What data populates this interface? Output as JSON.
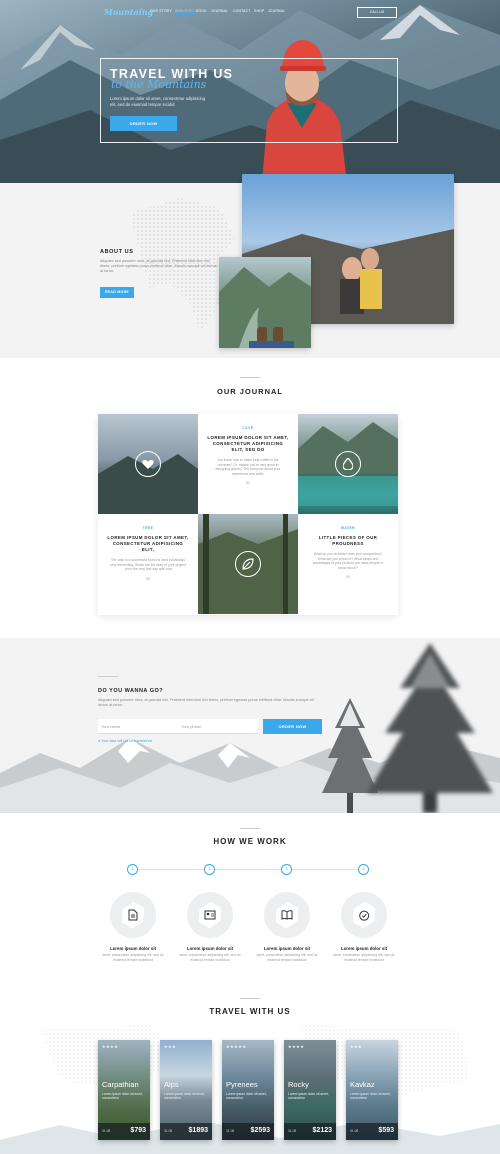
{
  "nav": {
    "logo": "Mountaing",
    "links": [
      "OUR STORY",
      "SERVICES",
      "BOOK",
      "JOURNAL",
      "CONTACT",
      "SHOP",
      "JOURNAL"
    ],
    "active_index": 1,
    "call_label": "CALL US"
  },
  "hero": {
    "title": "TRAVEL WITH US",
    "script_title": "to the Mountains",
    "desc_line1": "Lorem ipsum dolor sit amet, consectetur adipisicing",
    "desc_line2": "elit, sed do eiusmod tempor incidid",
    "button": "ORDER NOW"
  },
  "about": {
    "title": "ABOUT US",
    "text": "Aliquam sed posuere urna, at gravida nisl. Praesent interdum nisl libero, pretium egestas purus eleifend vitae. Mauris suscipit vel lectus at tortor.",
    "button": "READ MORE"
  },
  "journal": {
    "title": "OUR JOURNAL",
    "items": [
      {
        "tag": "LOVE",
        "title": "LOREM IPSUM DOLOR SIT AMET, CONSECTETUR ADIPISICING ELIT, SED DO",
        "text": "You know how to make best coffee in the universe? Or, maybe you're very good in designing gloves? Tell everyone about your experience and skills.",
        "num": "01"
      },
      {
        "tag": "TREE",
        "title": "LOREM IPSUM DOLOR SIT AMET, CONSECTETUR ADIPISICING ELIT,",
        "text": "The way to a successful brand is hard but always very interesting. Share the full story of your project - from the very first day until now.",
        "num": "02"
      },
      {
        "tag": "WATER",
        "title": "LITTLE PIECES OF OUR PROUDNESS",
        "text": "What do you do better than your competitors? What are you proud of? What ideals and advantages of your product you want people to know about?",
        "num": "03"
      }
    ],
    "icons": [
      "heart-icon",
      "drop-icon",
      "leaf-icon"
    ]
  },
  "go": {
    "title": "DO YOU WANNA GO?",
    "text": "Aliquam sed posuere urna, at gravida nisl. Praesent interdum nisl libero, pretium egestas purus eleifend vitae. Mauris suscipit vel lectus at tortor.",
    "name_placeholder": "Your name",
    "phone_placeholder": "Your phone",
    "button": "ORDER NOW",
    "note": "Your data will not be transferred"
  },
  "how": {
    "title": "HOW WE WORK",
    "steps": [
      {
        "num": "1",
        "icon": "document-icon",
        "title": "Lorem ipsum dolor sit",
        "text": "amet, consectetur adipisicing elit, sed do eiusmod tempor incididunt"
      },
      {
        "num": "2",
        "icon": "id-card-icon",
        "title": "Lorem ipsum dolor sit",
        "text": "amet, consectetur adipisicing elit, sed do eiusmod tempor incididunt"
      },
      {
        "num": "3",
        "icon": "book-icon",
        "title": "Lorem ipsum dolor sit",
        "text": "amet, consectetur adipisicing elit, sed do eiusmod tempor incididunt"
      },
      {
        "num": "4",
        "icon": "check-icon",
        "title": "Lorem ipsum dolor sit",
        "text": "amet, consectetur adipisicing elit, sed do eiusmod tempor incididunt"
      }
    ]
  },
  "travel": {
    "title": "TRAVEL WITH US",
    "cards": [
      {
        "stars": "★★★★",
        "name": "Carpathian",
        "desc": "Lorem ipsum dolor sit amet, consectetur",
        "date": "31.08",
        "price": "$793"
      },
      {
        "stars": "★★★",
        "name": "Alps",
        "desc": "Lorem ipsum dolor sit amet, consectetur",
        "date": "31.08",
        "price": "$1893"
      },
      {
        "stars": "★★★★★",
        "name": "Pyrenees",
        "desc": "Lorem ipsum dolor sit amet, consectetur",
        "date": "31.08",
        "price": "$2593"
      },
      {
        "stars": "★★★★",
        "name": "Rocky",
        "desc": "Lorem ipsum dolor sit amet, consectetur",
        "date": "31.08",
        "price": "$2123"
      },
      {
        "stars": "★★★",
        "name": "Kavkaz",
        "desc": "Lorem ipsum dolor sit amet, consectetur",
        "date": "31.08",
        "price": "$593"
      }
    ]
  },
  "colors": {
    "accent": "#3aa8ea",
    "dark": "#222222",
    "light_bg": "#f3f3f4"
  }
}
